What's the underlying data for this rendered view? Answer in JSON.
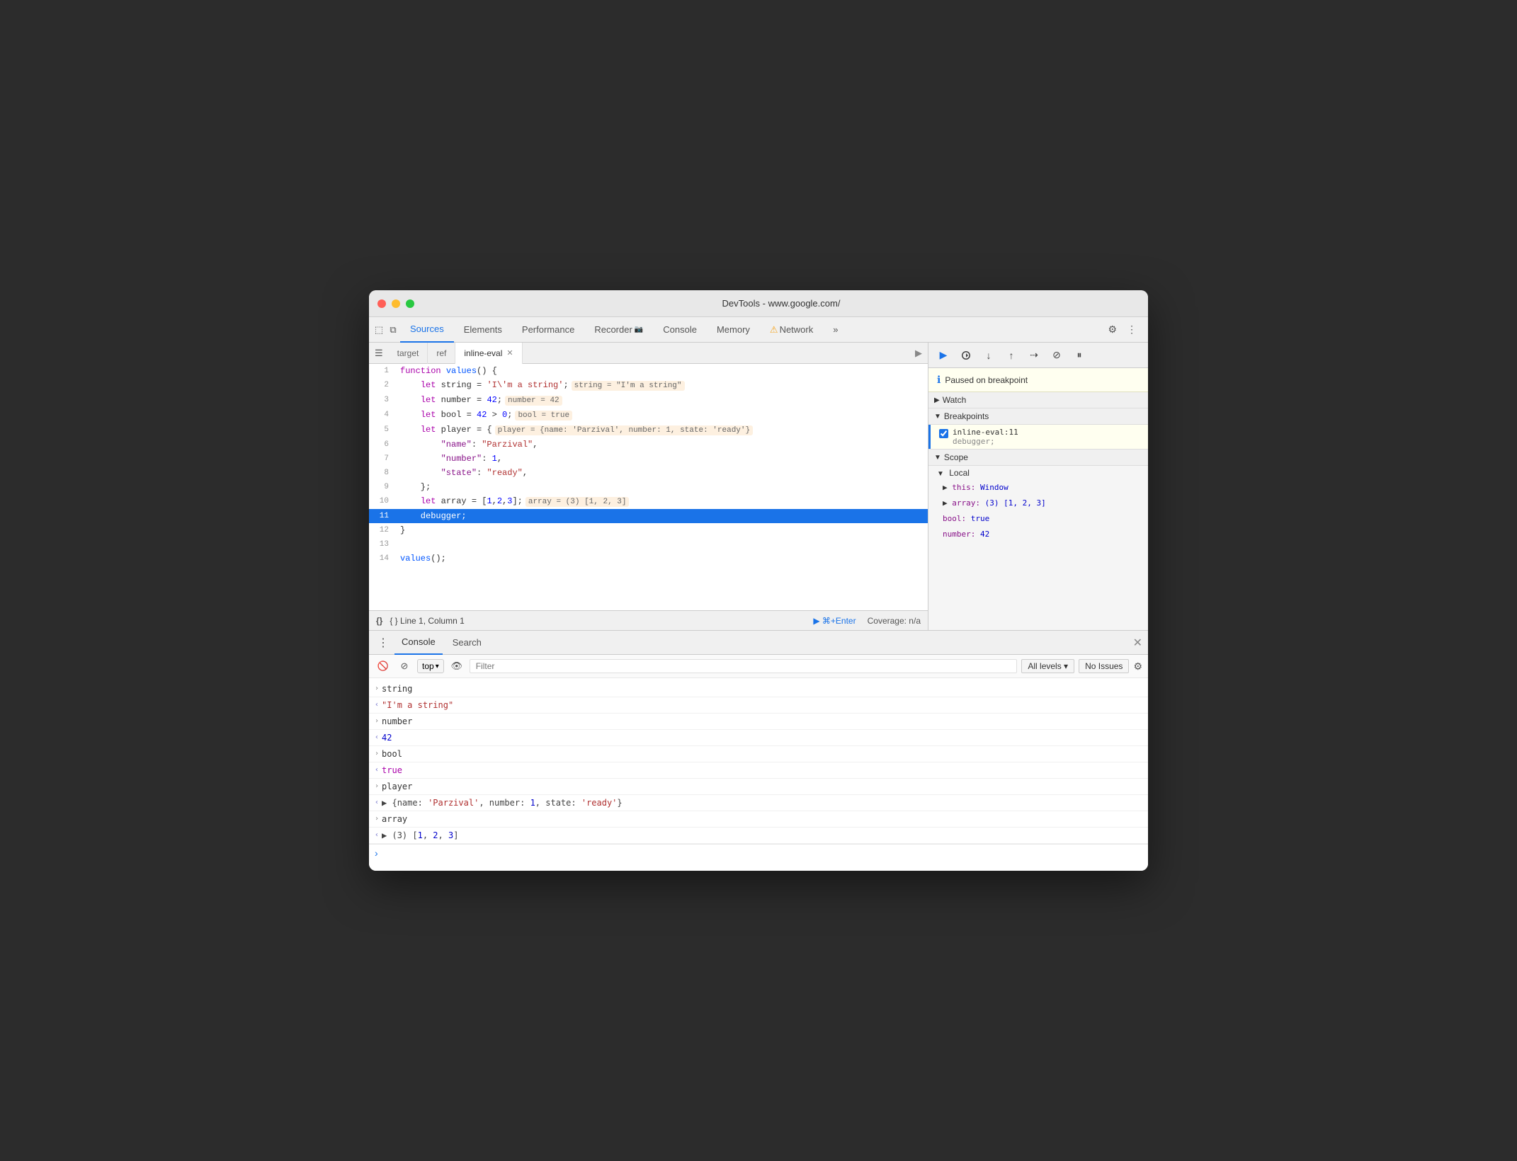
{
  "titlebar": {
    "title": "DevTools - www.google.com/"
  },
  "top_tabs": {
    "items": [
      {
        "label": "Sources",
        "active": true
      },
      {
        "label": "Elements",
        "active": false
      },
      {
        "label": "Performance",
        "active": false
      },
      {
        "label": "Recorder",
        "active": false
      },
      {
        "label": "Console",
        "active": false
      },
      {
        "label": "Memory",
        "active": false
      },
      {
        "label": "Network",
        "active": false
      }
    ],
    "more_label": "»",
    "settings_label": "⚙",
    "more_vert_label": "⋮"
  },
  "editor_tabs": {
    "file_tabs": [
      {
        "label": "target",
        "active": false
      },
      {
        "label": "ref",
        "active": false
      },
      {
        "label": "inline-eval",
        "active": true,
        "closeable": true
      }
    ]
  },
  "code": {
    "lines": [
      {
        "num": 1,
        "content": "function values() {",
        "highlighted": false
      },
      {
        "num": 2,
        "content": "    let string = 'I\\'m a string';",
        "highlighted": false,
        "inline": "string = \"I'm a string\""
      },
      {
        "num": 3,
        "content": "    let number = 42;",
        "highlighted": false,
        "inline": "number = 42"
      },
      {
        "num": 4,
        "content": "    let bool = 42 > 0;",
        "highlighted": false,
        "inline": "bool = true"
      },
      {
        "num": 5,
        "content": "    let player = {",
        "highlighted": false,
        "inline": "player = {name: 'Parzival', number: 1, state: 'ready'}"
      },
      {
        "num": 6,
        "content": "        \"name\": \"Parzival\",",
        "highlighted": false
      },
      {
        "num": 7,
        "content": "        \"number\": 1,",
        "highlighted": false
      },
      {
        "num": 8,
        "content": "        \"state\": \"ready\",",
        "highlighted": false
      },
      {
        "num": 9,
        "content": "    };",
        "highlighted": false
      },
      {
        "num": 10,
        "content": "    let array = [1,2,3];",
        "highlighted": false,
        "inline": "array = (3) [1, 2, 3]"
      },
      {
        "num": 11,
        "content": "    debugger;",
        "highlighted": true
      },
      {
        "num": 12,
        "content": "}",
        "highlighted": false
      },
      {
        "num": 13,
        "content": "",
        "highlighted": false
      },
      {
        "num": 14,
        "content": "values();",
        "highlighted": false
      }
    ]
  },
  "statusbar": {
    "left": "{ } Line 1, Column 1",
    "run_label": "▶ ⌘+Enter",
    "coverage": "Coverage: n/a"
  },
  "debugger": {
    "paused_text": "Paused on breakpoint",
    "watch_label": "Watch",
    "breakpoints_label": "Breakpoints",
    "bp_file": "inline-eval:11",
    "bp_code": "debugger;",
    "scope_label": "Scope",
    "local_label": "Local",
    "scope_items": [
      {
        "key": "this:",
        "val": "Window"
      },
      {
        "key": "▶ array:",
        "val": "(3) [1, 2, 3]"
      },
      {
        "key": "bool:",
        "val": "true"
      },
      {
        "key": "number:",
        "val": "42"
      }
    ]
  },
  "console": {
    "tabs": [
      {
        "label": "Console",
        "active": true
      },
      {
        "label": "Search",
        "active": false
      }
    ],
    "toolbar": {
      "top_label": "top",
      "filter_placeholder": "Filter",
      "all_levels_label": "All levels ▾",
      "no_issues_label": "No Issues"
    },
    "log_items": [
      {
        "arrow": "›",
        "type": "out",
        "text": "string",
        "text_type": "plain"
      },
      {
        "arrow": "‹",
        "type": "ret",
        "text": "\"I'm a string\"",
        "text_type": "string"
      },
      {
        "arrow": "›",
        "type": "out",
        "text": "number",
        "text_type": "plain"
      },
      {
        "arrow": "‹",
        "type": "ret",
        "text": "42",
        "text_type": "number"
      },
      {
        "arrow": "›",
        "type": "out",
        "text": "bool",
        "text_type": "plain"
      },
      {
        "arrow": "‹",
        "type": "ret",
        "text": "true",
        "text_type": "bool"
      },
      {
        "arrow": "›",
        "type": "out",
        "text": "player",
        "text_type": "plain"
      },
      {
        "arrow": "‹",
        "type": "ret",
        "text": "▶ {name: 'Parzival', number: 1, state: 'ready'}",
        "text_type": "obj"
      },
      {
        "arrow": "›",
        "type": "out",
        "text": "array",
        "text_type": "plain"
      },
      {
        "arrow": "‹",
        "type": "ret",
        "text": "▶ (3) [1, 2, 3]",
        "text_type": "obj"
      }
    ],
    "prompt_arrow": "›"
  }
}
